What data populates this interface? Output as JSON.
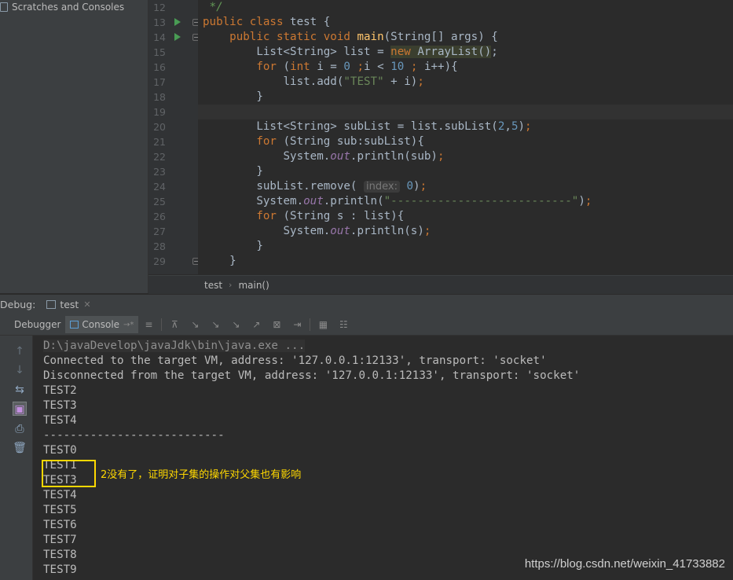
{
  "project_panel": {
    "scratches_label": "Scratches and Consoles"
  },
  "editor": {
    "line_numbers": [
      "12",
      "13",
      "14",
      "15",
      "16",
      "17",
      "18",
      "19",
      "20",
      "21",
      "22",
      "23",
      "24",
      "25",
      "26",
      "27",
      "28",
      "29"
    ],
    "hint_label": "index:"
  },
  "breadcrumb": {
    "items": [
      "test",
      "main()"
    ],
    "separator": "›"
  },
  "debug": {
    "title": "Debug:",
    "session_tab": "test",
    "tabs": {
      "debugger": "Debugger",
      "console": "Console"
    },
    "console_lines": [
      "D:\\javaDevelop\\javaJdk\\bin\\java.exe ...",
      "Connected to the target VM, address: '127.0.0.1:12133', transport: 'socket'",
      "Disconnected from the target VM, address: '127.0.0.1:12133', transport: 'socket'",
      "TEST2",
      "TEST3",
      "TEST4",
      "---------------------------",
      "TEST0",
      "TEST1",
      "TEST3",
      "TEST4",
      "TEST5",
      "TEST6",
      "TEST7",
      "TEST8",
      "TEST9"
    ]
  },
  "annotation": {
    "text": "2没有了，证明对子集的操作对父集也有影响",
    "color": "#ffd800"
  },
  "watermark": "https://blog.csdn.net/weixin_41733882",
  "colors": {
    "keyword": "#cc7832",
    "number": "#6897bb",
    "string": "#6a8759",
    "static_field": "#9876aa",
    "method_decl": "#ffc66d",
    "run_icon": "#499c54"
  },
  "icons": [
    "run-icon",
    "fold-icon",
    "close-icon",
    "up-arrow-icon",
    "down-arrow-icon",
    "print-icon",
    "trash-icon"
  ]
}
